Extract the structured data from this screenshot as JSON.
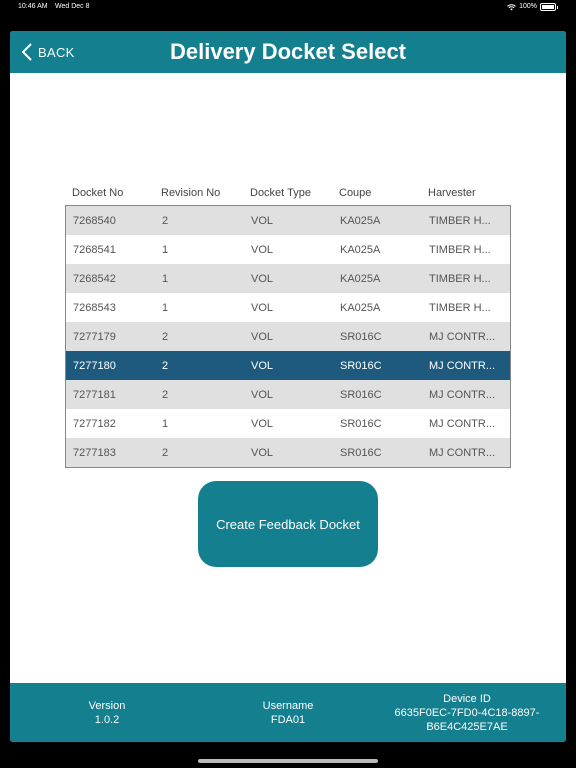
{
  "status_bar": {
    "time": "10:46 AM",
    "date": "Wed Dec 8",
    "battery": "100%"
  },
  "header": {
    "back_label": "BACK",
    "title": "Delivery Docket Select"
  },
  "table": {
    "columns": [
      "Docket No",
      "Revision No",
      "Docket Type",
      "Coupe",
      "Harvester"
    ],
    "rows": [
      [
        "7268540",
        "2",
        "VOL",
        "KA025A",
        "TIMBER H..."
      ],
      [
        "7268541",
        "1",
        "VOL",
        "KA025A",
        "TIMBER H..."
      ],
      [
        "7268542",
        "1",
        "VOL",
        "KA025A",
        "TIMBER H..."
      ],
      [
        "7268543",
        "1",
        "VOL",
        "KA025A",
        "TIMBER H..."
      ],
      [
        "7277179",
        "2",
        "VOL",
        "SR016C",
        "MJ CONTR..."
      ],
      [
        "7277180",
        "2",
        "VOL",
        "SR016C",
        "MJ CONTR..."
      ],
      [
        "7277181",
        "2",
        "VOL",
        "SR016C",
        "MJ CONTR..."
      ],
      [
        "7277182",
        "1",
        "VOL",
        "SR016C",
        "MJ CONTR..."
      ],
      [
        "7277183",
        "2",
        "VOL",
        "SR016C",
        "MJ CONTR..."
      ]
    ],
    "selected_row": 5
  },
  "actions": {
    "create_label": "Create Feedback Docket"
  },
  "footer": {
    "version_label": "Version",
    "version_value": "1.0.2",
    "username_label": "Username",
    "username_value": "FDA01",
    "device_label": "Device ID",
    "device_value": "6635F0EC-7FD0-4C18-8897-B6E4C425E7AE"
  },
  "colors": {
    "accent": "#137f8f",
    "selected_row": "#1e5a7d",
    "stripe": "#e0e0e0"
  }
}
